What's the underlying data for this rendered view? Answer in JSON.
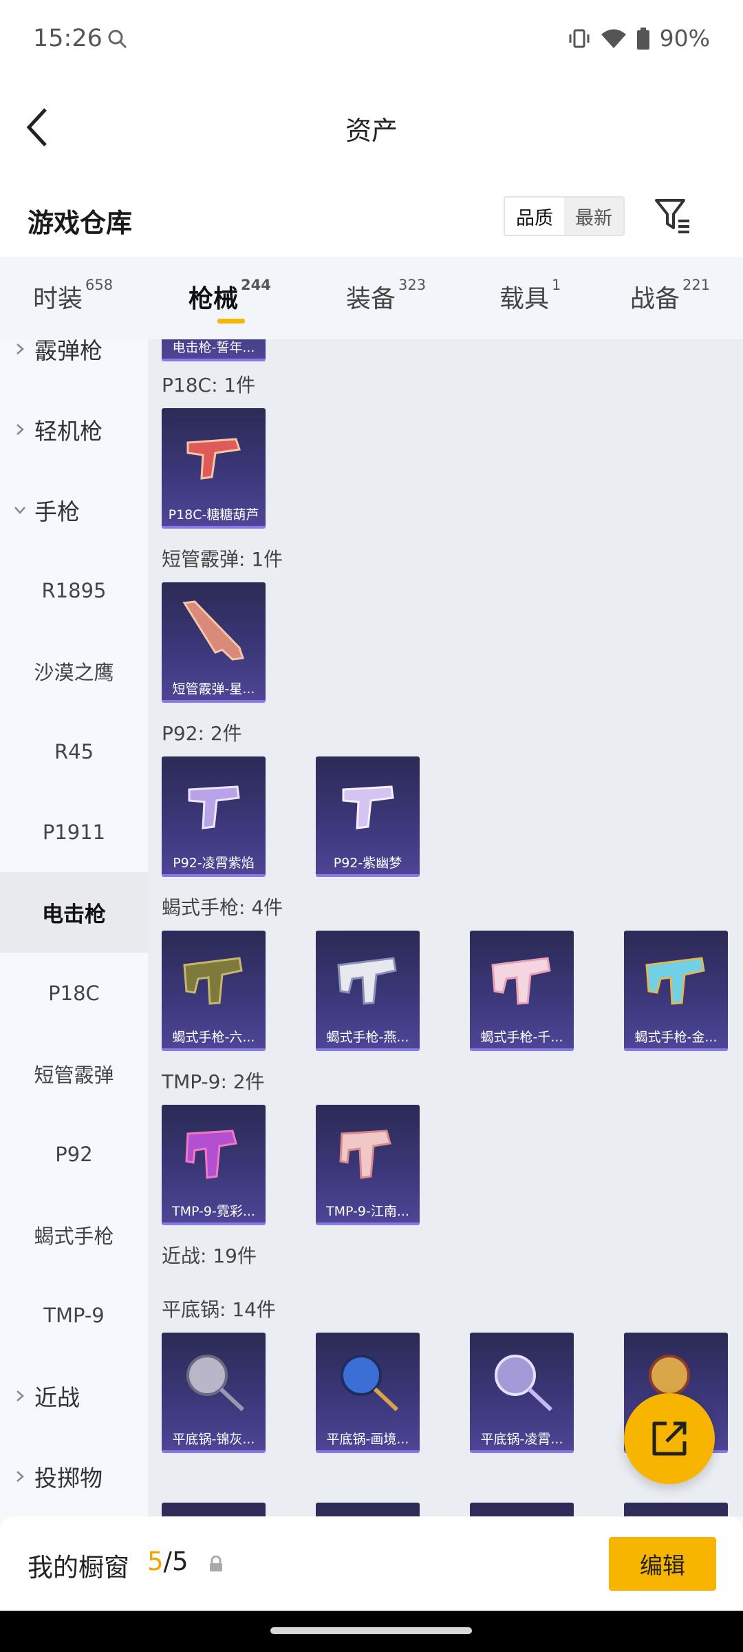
{
  "status": {
    "time": "15:26",
    "battery": "90%"
  },
  "nav": {
    "title": "资产"
  },
  "warehouse": {
    "title": "游戏仓库",
    "sort_quality": "品质",
    "sort_latest": "最新"
  },
  "tabs": [
    {
      "label": "时装",
      "count": "658"
    },
    {
      "label": "枪械",
      "count": "244"
    },
    {
      "label": "装备",
      "count": "323"
    },
    {
      "label": "载具",
      "count": "1"
    },
    {
      "label": "战备",
      "count": "221"
    }
  ],
  "sidebar": {
    "groups": {
      "shotgun": "霰弹枪",
      "lmg": "轻机枪",
      "pistol": "手枪",
      "melee": "近战",
      "throwable": "投掷物"
    },
    "pistols": [
      "R1895",
      "沙漠之鹰",
      "R45",
      "P1911",
      "电击枪",
      "P18C",
      "短管霰弹",
      "P92",
      "蝎式手枪",
      "TMP-9"
    ]
  },
  "content": {
    "top_partial_name": "电击枪-誓年...",
    "groups": [
      {
        "label": "P18C: 1件",
        "items": [
          "P18C-糖糖葫芦"
        ]
      },
      {
        "label": "短管霰弹: 1件",
        "items": [
          "短管霰弹-星..."
        ]
      },
      {
        "label": "P92: 2件",
        "items": [
          "P92-凌霄紫焰",
          "P92-紫幽梦"
        ]
      },
      {
        "label": "蝎式手枪: 4件",
        "items": [
          "蝎式手枪-六...",
          "蝎式手枪-燕...",
          "蝎式手枪-千...",
          "蝎式手枪-金..."
        ]
      },
      {
        "label": "TMP-9: 2件",
        "items": [
          "TMP-9-霓彩...",
          "TMP-9-江南..."
        ]
      },
      {
        "label": "近战: 19件",
        "items": []
      },
      {
        "label": "平底锅: 14件",
        "items": [
          "平底锅-锦灰...",
          "平底锅-画境...",
          "平底锅-凌霄...",
          ""
        ]
      }
    ]
  },
  "bottom": {
    "label": "我的橱窗",
    "current": "5",
    "total": "/5",
    "edit": "编辑"
  },
  "colors": {
    "accent": "#f7b500",
    "card_border": "#8a78e6"
  }
}
